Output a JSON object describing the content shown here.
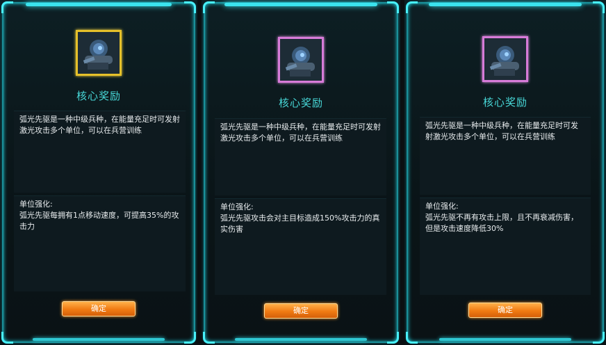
{
  "panels": [
    {
      "title": "核心奖励",
      "frame_color": "gold",
      "description": "弧光先驱是一种中级兵种，在能量充足时可发射激光攻击多个单位，可以在兵营训练",
      "bonus_heading": "单位强化:",
      "bonus_text": "弧光先驱每拥有1点移动速度，可提高35%的攻击力",
      "confirm_label": "确定"
    },
    {
      "title": "核心奖励",
      "frame_color": "pink",
      "description": "弧光先驱是一种中级兵种，在能量充足时可发射激光攻击多个单位，可以在兵营训练",
      "bonus_heading": "单位强化:",
      "bonus_text": "弧光先驱攻击会对主目标造成150%攻击力的真实伤害",
      "confirm_label": "确定"
    },
    {
      "title": "核心奖励",
      "frame_color": "pink",
      "description": "弧光先驱是一种中级兵种，在能量充足时可发射激光攻击多个单位，可以在兵营训练",
      "bonus_heading": "单位强化:",
      "bonus_text": "弧光先驱不再有攻击上限，且不再衰减伤害，但是攻击速度降低30%",
      "confirm_label": "确定"
    }
  ],
  "colors": {
    "accent_cyan": "#3be3ee",
    "title_teal": "#48d8d8",
    "gold_frame": "#e6c12a",
    "pink_frame": "#d77bd8",
    "button_orange": "#f07a12"
  },
  "icons": [
    "unit-portrait-icon"
  ]
}
